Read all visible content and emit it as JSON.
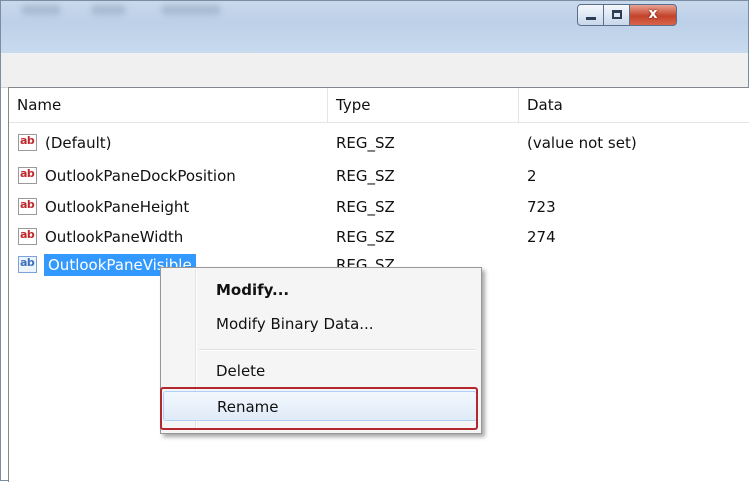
{
  "window": {
    "minimize_icon": "minimize-icon",
    "maximize_icon": "maximize-icon",
    "close_glyph": "x"
  },
  "list": {
    "columns": [
      "Name",
      "Type",
      "Data"
    ],
    "rows": [
      {
        "icon": "string-value-icon",
        "name": "(Default)",
        "type": "REG_SZ",
        "data": "(value not set)"
      },
      {
        "icon": "string-value-icon",
        "name": "OutlookPaneDockPosition",
        "type": "REG_SZ",
        "data": "2"
      },
      {
        "icon": "string-value-icon",
        "name": "OutlookPaneHeight",
        "type": "REG_SZ",
        "data": "723"
      },
      {
        "icon": "string-value-icon",
        "name": "OutlookPaneWidth",
        "type": "REG_SZ",
        "data": "274"
      },
      {
        "icon": "string-value-icon",
        "name": "OutlookPaneVisible",
        "type": "REG_SZ",
        "data": "",
        "selected": true
      }
    ],
    "icon_text": "ab"
  },
  "context_menu": {
    "items": [
      {
        "label": "Modify...",
        "bold": true
      },
      {
        "label": "Modify Binary Data..."
      },
      {
        "label": "Delete"
      },
      {
        "label": "Rename",
        "highlighted": true
      }
    ]
  },
  "colors": {
    "selection": "#3399ff",
    "highlight_border": "#b3282e"
  }
}
